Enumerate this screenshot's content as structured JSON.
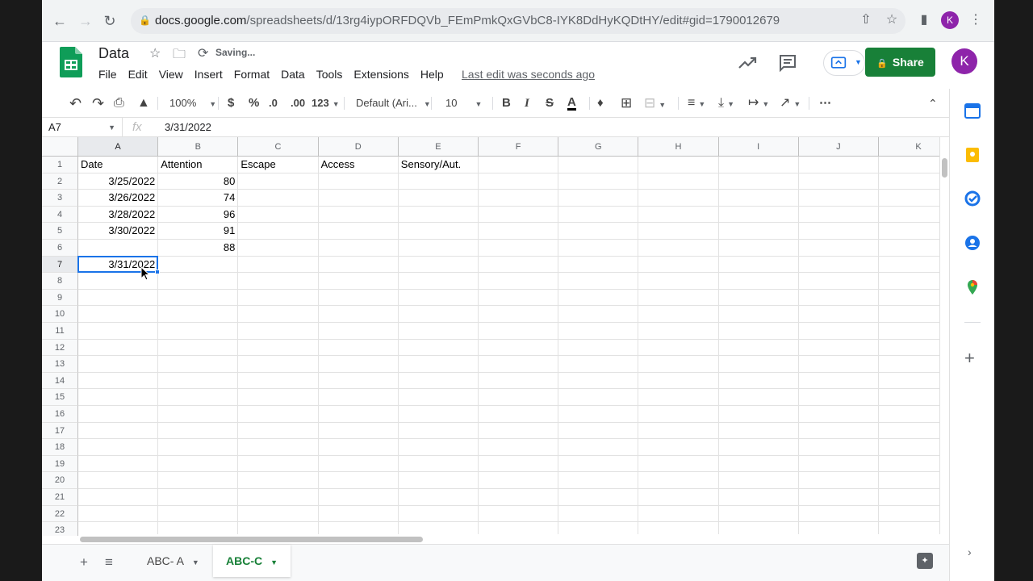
{
  "browser": {
    "url_host": "docs.google.com",
    "url_path": "/spreadsheets/d/13rg4iypORFDQVb_FEmPmkQxGVbC8-IYK8DdHyKQDtHY/edit#gid=1790012679",
    "profile_initial": "K"
  },
  "doc": {
    "title": "Data",
    "status": "Saving...",
    "last_edit": "Last edit was seconds ago",
    "share_label": "Share",
    "user_initial": "K"
  },
  "menu": [
    "File",
    "Edit",
    "View",
    "Insert",
    "Format",
    "Data",
    "Tools",
    "Extensions",
    "Help"
  ],
  "toolbar": {
    "zoom": "100%",
    "currency": "$",
    "percent": "%",
    "dec_decrease": ".0",
    "dec_increase": ".00",
    "more_formats": "123",
    "font": "Default (Ari...",
    "font_size": "10",
    "bold": "B",
    "italic": "I",
    "strike": "S",
    "text_color": "A"
  },
  "formula_bar": {
    "cell_ref": "A7",
    "fx": "fx",
    "value": "3/31/2022"
  },
  "grid": {
    "columns": [
      "A",
      "B",
      "C",
      "D",
      "E",
      "F",
      "G",
      "H",
      "I",
      "J",
      "K"
    ],
    "rows": [
      "1",
      "2",
      "3",
      "4",
      "5",
      "6",
      "7",
      "8",
      "9",
      "10",
      "11",
      "12",
      "13",
      "14",
      "15",
      "16",
      "17",
      "18",
      "19",
      "20",
      "21",
      "22",
      "23"
    ],
    "cells": [
      [
        "Date",
        "Attention",
        "Escape",
        "Access",
        "Sensory/Aut."
      ],
      [
        "3/25/2022",
        "80",
        "",
        "",
        ""
      ],
      [
        "3/26/2022",
        "74",
        "",
        "",
        ""
      ],
      [
        "3/28/2022",
        "96",
        "",
        "",
        ""
      ],
      [
        "3/30/2022",
        "91",
        "",
        "",
        ""
      ],
      [
        "",
        "88",
        "",
        "",
        ""
      ],
      [
        "3/31/2022",
        "",
        "",
        "",
        ""
      ]
    ],
    "selected_row": 7,
    "selected_col": "A"
  },
  "sheets": [
    {
      "label": "ABC- A",
      "active": false
    },
    {
      "label": "ABC-C",
      "active": true
    }
  ],
  "colors": {
    "accent": "#1a73e8",
    "share": "#188038",
    "avatar": "#8e24aa"
  }
}
